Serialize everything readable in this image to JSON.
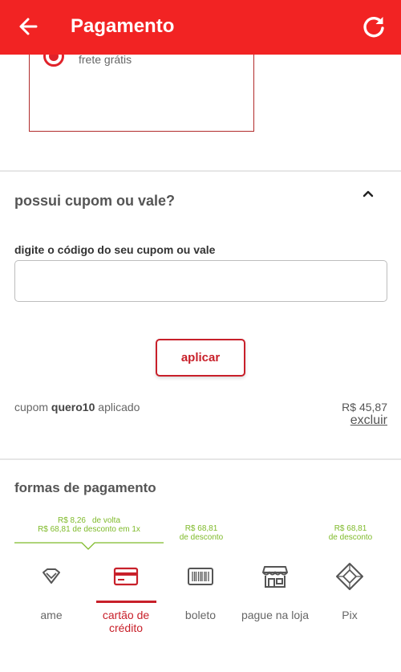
{
  "appbar": {
    "title": "Pagamento",
    "back_icon": "arrow-left-icon",
    "refresh_icon": "refresh-icon",
    "color": "#f22323"
  },
  "shipping": {
    "option_text": "frete grátis",
    "selected": true
  },
  "coupon": {
    "title": "possui cupom ou vale?",
    "field_label": "digite o código do seu cupom ou vale",
    "input_value": "",
    "apply_label": "aplicar",
    "applied_prefix": "cupom",
    "applied_code": "quero10",
    "applied_suffix": "aplicado",
    "applied_value": "R$ 45,87",
    "remove_label": "excluir"
  },
  "payment": {
    "title": "formas de pagamento",
    "promo_main": {
      "cashback": "R$ 8,26",
      "cashback_suffix": "de volta",
      "discount": "R$ 68,81 de desconto em 1x"
    },
    "promo_boleto": {
      "value": "R$ 68,81",
      "suffix": "de desconto"
    },
    "promo_pix": {
      "value": "R$ 68,81",
      "suffix": "de desconto"
    },
    "methods": [
      {
        "label": "ame",
        "icon": "ame-diamond-icon"
      },
      {
        "label": "cartão de crédito",
        "icon": "credit-card-icon",
        "selected": true
      },
      {
        "label": "boleto",
        "icon": "barcode-icon"
      },
      {
        "label": "pague na loja",
        "icon": "store-icon"
      },
      {
        "label": "Pix",
        "icon": "pix-icon"
      }
    ],
    "accent_color": "#c8202a",
    "promo_color": "#7fba2a"
  }
}
